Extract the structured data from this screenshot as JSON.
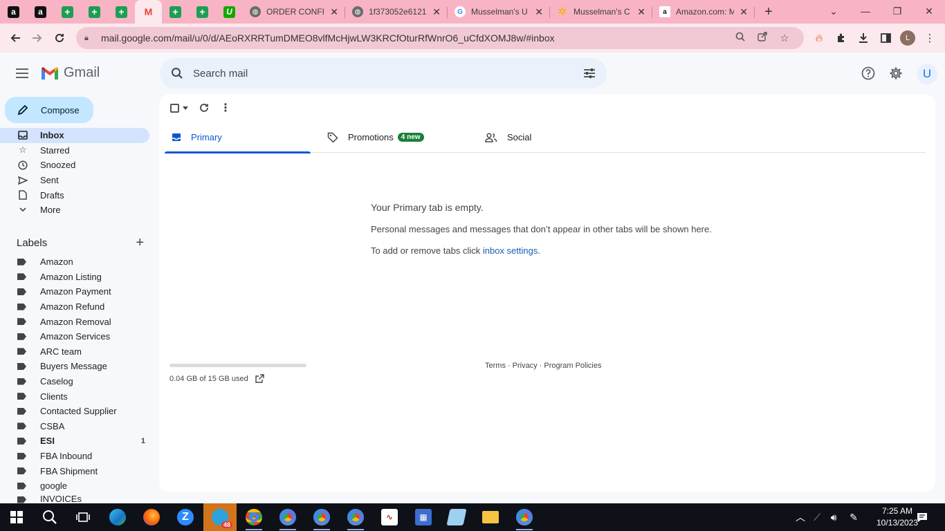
{
  "browser": {
    "pinned_tabs": [
      {
        "icon": "amazon-icon",
        "glyph": "a"
      },
      {
        "icon": "amazon-icon",
        "glyph": "a"
      },
      {
        "icon": "sheets-icon",
        "glyph": "+"
      },
      {
        "icon": "sheets-icon",
        "glyph": "+"
      },
      {
        "icon": "sheets-icon",
        "glyph": "+"
      },
      {
        "icon": "gmail-icon",
        "glyph": "M"
      },
      {
        "icon": "sheets-icon",
        "glyph": "+"
      },
      {
        "icon": "sheets-icon",
        "glyph": "+"
      },
      {
        "icon": "upwork-icon",
        "glyph": "U"
      }
    ],
    "tabs": [
      {
        "title": "ORDER CONFIR",
        "icon": "globe-icon"
      },
      {
        "title": "1f373052e6121",
        "icon": "globe-icon"
      },
      {
        "title": "Musselman's U",
        "icon": "google-icon"
      },
      {
        "title": "Musselman's C",
        "icon": "star-icon"
      },
      {
        "title": "Amazon.com: M",
        "icon": "amazon-icon"
      }
    ],
    "url": "mail.google.com/mail/u/0/d/AEoRXRRTumDMEO8vlfMcHjwLW3KRCfOturRfWnrO6_uCfdXOMJ8w/#inbox",
    "profile_initial": "L"
  },
  "gmail": {
    "product_name": "Gmail",
    "search_placeholder": "Search mail",
    "account_initial": "U",
    "compose_label": "Compose",
    "nav": [
      {
        "label": "Inbox",
        "icon": "inbox-icon",
        "active": true
      },
      {
        "label": "Starred",
        "icon": "star-icon"
      },
      {
        "label": "Snoozed",
        "icon": "clock-icon"
      },
      {
        "label": "Sent",
        "icon": "send-icon"
      },
      {
        "label": "Drafts",
        "icon": "draft-icon"
      },
      {
        "label": "More",
        "icon": "chevron-down-icon"
      }
    ],
    "labels_heading": "Labels",
    "labels": [
      {
        "label": "Amazon"
      },
      {
        "label": "Amazon Listing"
      },
      {
        "label": "Amazon Payment"
      },
      {
        "label": "Amazon Refund"
      },
      {
        "label": "Amazon Removal"
      },
      {
        "label": "Amazon Services"
      },
      {
        "label": "ARC team"
      },
      {
        "label": "Buyers Message"
      },
      {
        "label": "Caselog"
      },
      {
        "label": "Clients"
      },
      {
        "label": "Contacted Supplier"
      },
      {
        "label": "CSBA"
      },
      {
        "label": "ESI",
        "count": "1",
        "bold": true
      },
      {
        "label": "FBA Inbound"
      },
      {
        "label": "FBA Shipment"
      },
      {
        "label": "google"
      },
      {
        "label": "INVOICEs"
      }
    ],
    "inbox_tabs": [
      {
        "label": "Primary",
        "icon": "inbox-icon",
        "active": true
      },
      {
        "label": "Promotions",
        "icon": "tag-icon",
        "badge": "4 new"
      },
      {
        "label": "Social",
        "icon": "people-icon"
      }
    ],
    "empty_state": {
      "title": "Your Primary tab is empty.",
      "body": "Personal messages and messages that don’t appear in other tabs will be shown here.",
      "settings_prefix": "To add or remove tabs click ",
      "settings_link": "inbox settings",
      "settings_suffix": "."
    },
    "storage": {
      "text": "0.04 GB of 15 GB used",
      "fraction": 0.003
    },
    "footer": {
      "terms": "Terms",
      "privacy": "Privacy",
      "policies": "Program Policies",
      "separator": "·"
    }
  },
  "taskbar": {
    "telegram_badge": "48",
    "clock_time": "7:25 AM",
    "clock_date": "10/13/2023"
  },
  "colors": {
    "tab_strip": "#f8b4c4",
    "compose": "#c2e7ff",
    "active_nav": "#d3e3fd",
    "accent": "#0b57d0",
    "badge_green": "#188038"
  }
}
